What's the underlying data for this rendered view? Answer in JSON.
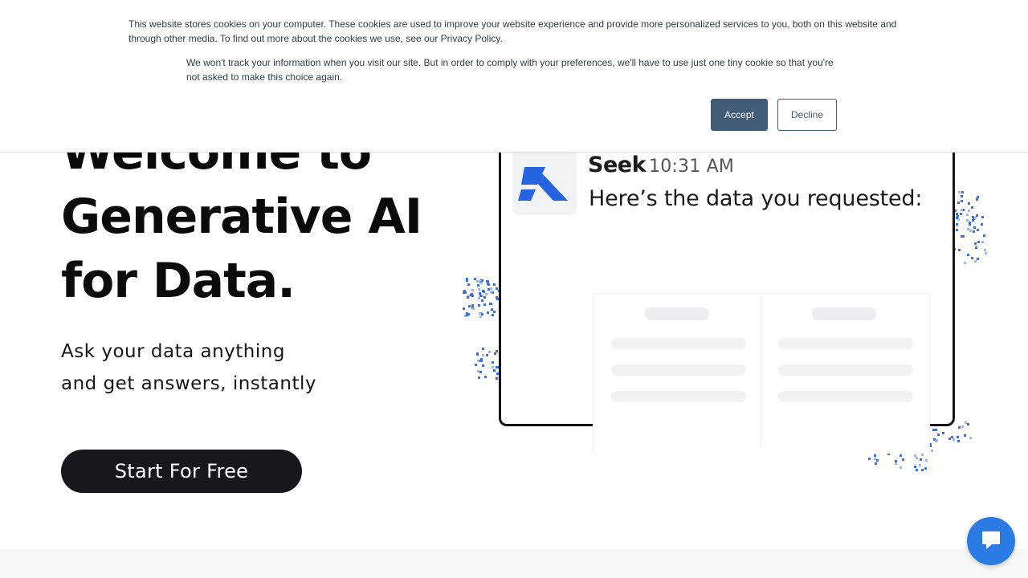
{
  "hero": {
    "title_lines": [
      "Welcome to",
      "Generative AI",
      "for Data."
    ],
    "subtitle_lines": [
      "Ask your data anything",
      "and get answers, instantly"
    ],
    "cta_label": "Start For Free"
  },
  "chat_preview": {
    "sender": "Seek",
    "time": "10:31 AM",
    "message": "Here’s the data you requested:",
    "avatar_icon": "seek-logo-icon"
  },
  "cookie_banner": {
    "text_primary": "This website stores cookies on your computer. These cookies are used to improve your website experience and provide more personalized services to you, both on this website and through other media. To find out more about the cookies we use, see our Privacy Policy.",
    "text_secondary": "We won't track your information when you visit our site. But in order to comply with your preferences, we'll have to use just one tiny cookie so that you're not asked to make this choice again.",
    "accept_label": "Accept",
    "decline_label": "Decline"
  },
  "chat_launcher": {
    "icon": "chat-bubble-icon"
  },
  "colors": {
    "accent_blue": "#2c7be5",
    "dot_blue": "#3d6fe0",
    "cta_bg": "#16181d",
    "accept_bg": "#425b76"
  }
}
